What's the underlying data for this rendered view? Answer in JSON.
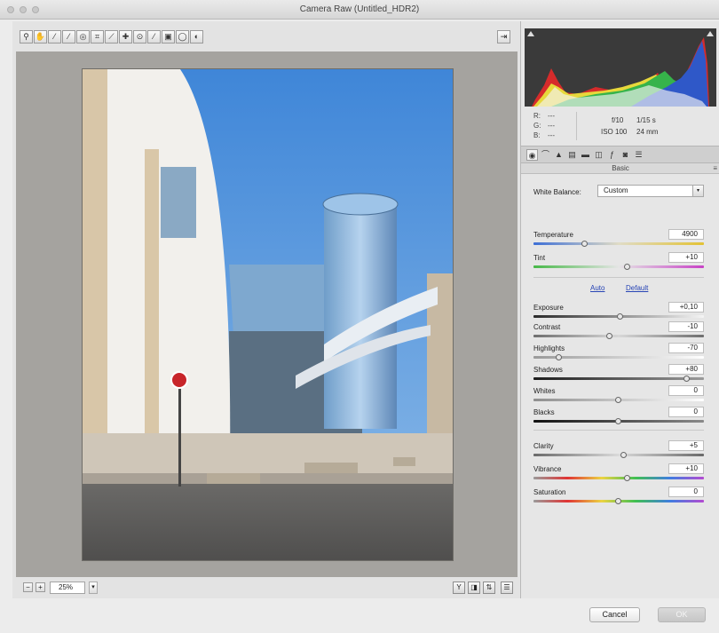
{
  "window": {
    "title": "Camera Raw (Untitled_HDR2)"
  },
  "toolbar": {
    "tools": [
      {
        "icon": "zoom-icon",
        "glyph": "⚲"
      },
      {
        "icon": "hand-icon",
        "glyph": "✋"
      },
      {
        "icon": "white-balance-icon",
        "glyph": "⁄"
      },
      {
        "icon": "color-sampler-icon",
        "glyph": "⁄"
      },
      {
        "icon": "targeted-adjustment-icon",
        "glyph": "◎"
      },
      {
        "icon": "crop-icon",
        "glyph": "⌗"
      },
      {
        "icon": "straighten-icon",
        "glyph": "⟋"
      },
      {
        "icon": "spot-removal-icon",
        "glyph": "✚"
      },
      {
        "icon": "red-eye-icon",
        "glyph": "⊙"
      },
      {
        "icon": "adjustment-brush-icon",
        "glyph": "⁄"
      },
      {
        "icon": "graduated-filter-icon",
        "glyph": "▣"
      },
      {
        "icon": "radial-filter-icon",
        "glyph": "◯"
      },
      {
        "icon": "preferences-icon",
        "glyph": "◐"
      }
    ],
    "fullscreen_icon": "fullscreen-icon"
  },
  "bottom_bar": {
    "zoom": "25%"
  },
  "histogram": {
    "r_label": "R:",
    "g_label": "G:",
    "b_label": "B:",
    "r_value": "---",
    "g_value": "---",
    "b_value": "---",
    "aperture": "f/10",
    "shutter": "1/15 s",
    "iso": "ISO 100",
    "focal": "24 mm"
  },
  "panel": {
    "section_title": "Basic",
    "white_balance_label": "White Balance:",
    "white_balance_value": "Custom",
    "auto_link": "Auto",
    "default_link": "Default"
  },
  "controls": [
    {
      "label": "Temperature",
      "value": "4900",
      "position": 0.3
    },
    {
      "label": "Tint",
      "value": "+10",
      "position": 0.55
    },
    {
      "label": "Exposure",
      "value": "+0,10",
      "position": 0.51
    },
    {
      "label": "Contrast",
      "value": "-10",
      "position": 0.45
    },
    {
      "label": "Highlights",
      "value": "-70",
      "position": 0.15
    },
    {
      "label": "Shadows",
      "value": "+80",
      "position": 0.9
    },
    {
      "label": "Whites",
      "value": "0",
      "position": 0.5
    },
    {
      "label": "Blacks",
      "value": "0",
      "position": 0.5
    },
    {
      "label": "Clarity",
      "value": "+5",
      "position": 0.53
    },
    {
      "label": "Vibrance",
      "value": "+10",
      "position": 0.55
    },
    {
      "label": "Saturation",
      "value": "0",
      "position": 0.5
    }
  ],
  "footer": {
    "cancel": "Cancel",
    "ok": "OK"
  },
  "colors": {
    "ok_button": "#c9c9c9",
    "link": "#2744b5",
    "preview_bg": "#a5a39f"
  }
}
